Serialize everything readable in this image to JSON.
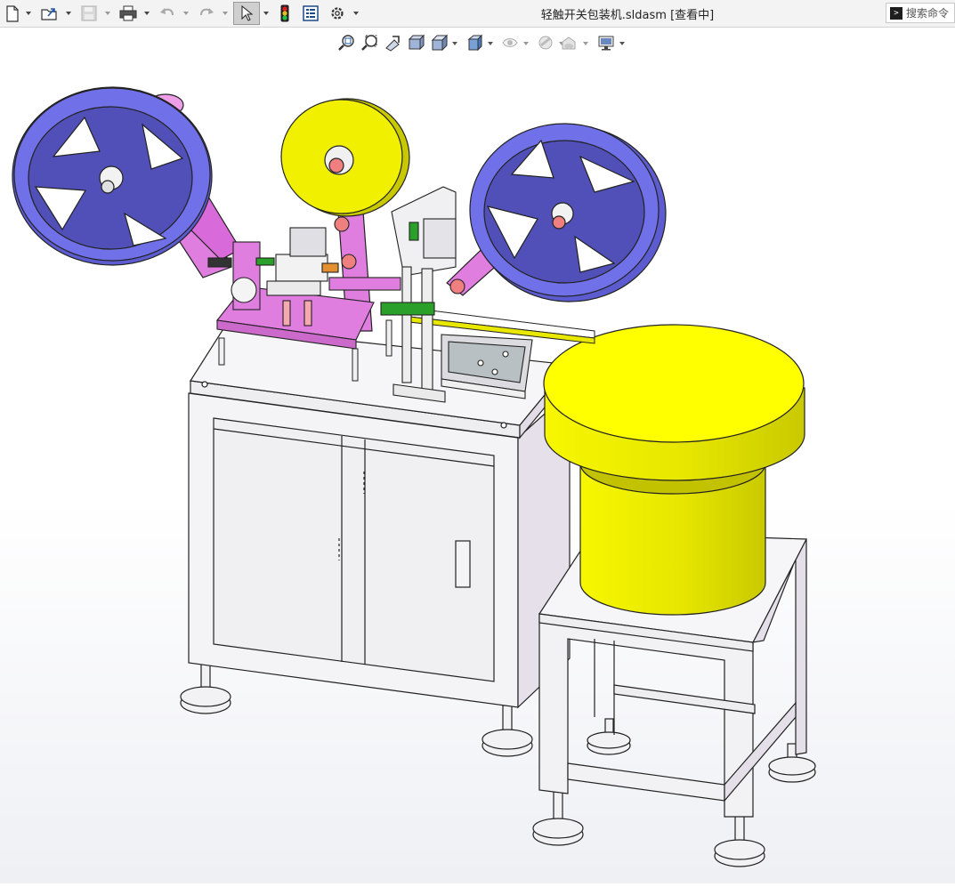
{
  "window": {
    "title": "轻触开关包装机.sldasm [查看中]"
  },
  "toolbar": {
    "items": [
      {
        "name": "new-document",
        "icon": "new-document-icon",
        "has_menu": true
      },
      {
        "name": "open",
        "icon": "open-folder-icon",
        "has_menu": true
      },
      {
        "name": "save",
        "icon": "save-icon",
        "has_menu": true,
        "disabled": true
      },
      {
        "name": "print",
        "icon": "print-icon",
        "has_menu": true
      },
      {
        "name": "undo",
        "icon": "undo-icon",
        "has_menu": true,
        "disabled": true
      },
      {
        "name": "redo",
        "icon": "redo-icon",
        "has_menu": true,
        "disabled": true
      },
      {
        "name": "select",
        "icon": "cursor-arrow-icon",
        "has_menu": true,
        "active": true
      },
      {
        "name": "rebuild",
        "icon": "traffic-light-icon"
      },
      {
        "name": "file-properties",
        "icon": "properties-icon"
      },
      {
        "name": "options",
        "icon": "gear-icon",
        "has_menu": true
      }
    ]
  },
  "search": {
    "placeholder": "搜索命令"
  },
  "view_toolbar": {
    "items": [
      {
        "name": "zoom-to-fit",
        "icon": "zoom-fit-icon"
      },
      {
        "name": "zoom-to-area",
        "icon": "zoom-area-icon"
      },
      {
        "name": "previous-view",
        "icon": "previous-view-icon"
      },
      {
        "name": "section-view",
        "icon": "section-view-icon"
      },
      {
        "name": "view-orientation",
        "icon": "view-cube-icon",
        "has_menu": true
      },
      {
        "name": "display-style",
        "icon": "display-style-icon",
        "has_menu": true
      },
      {
        "name": "hide-show-items",
        "icon": "eye-icon",
        "has_menu": true
      },
      {
        "name": "edit-appearance",
        "icon": "appearance-icon",
        "has_menu": true
      },
      {
        "name": "apply-scene",
        "icon": "scene-icon",
        "has_menu": true
      },
      {
        "name": "view-settings",
        "icon": "monitor-icon",
        "has_menu": true
      }
    ]
  },
  "colors": {
    "reel_blue": "#6e6ee6",
    "bracket_magenta": "#e07ee0",
    "hopper_yellow": "#f0f000",
    "frame_white": "#f4f4f6"
  }
}
